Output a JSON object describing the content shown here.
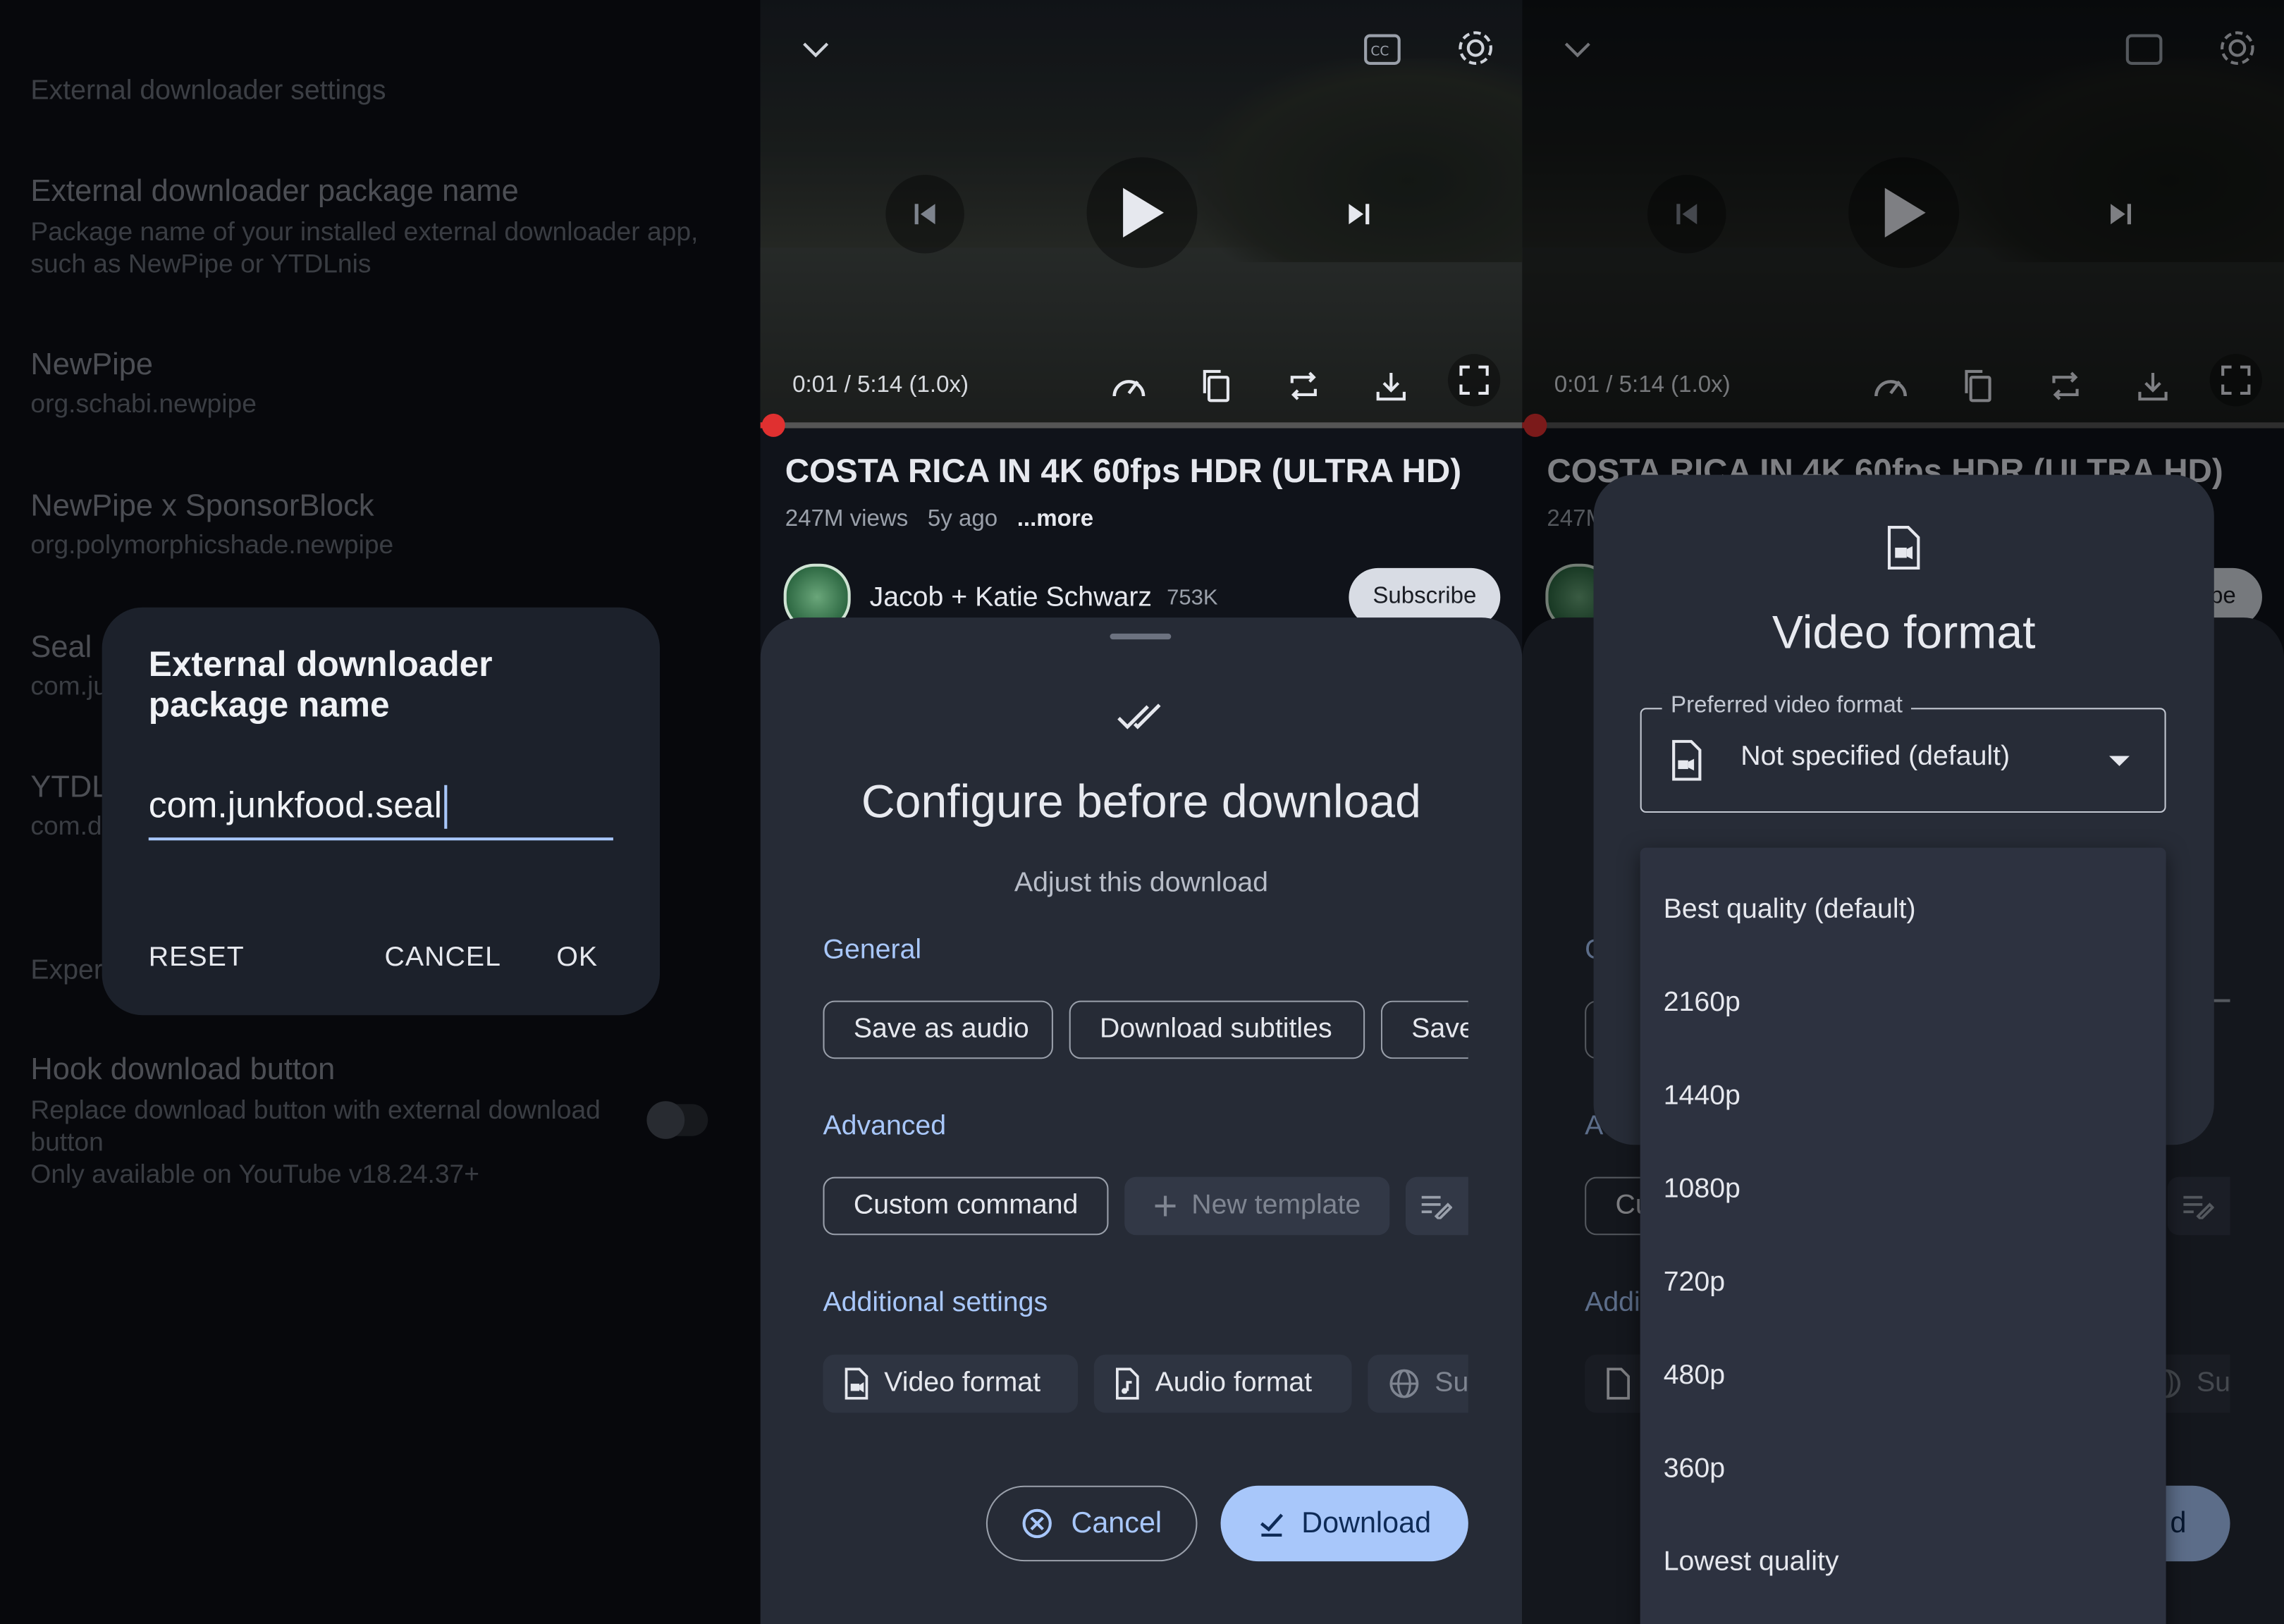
{
  "settings": {
    "header": "External downloader settings",
    "package_name": {
      "title": "External downloader package name",
      "desc": "Package name of your installed external downloader app, such as NewPipe or YTDLnis"
    },
    "options": [
      {
        "title": "NewPipe",
        "value": "org.schabi.newpipe"
      },
      {
        "title": "NewPipe x SponsorBlock",
        "value": "org.polymorphicshade.newpipe"
      },
      {
        "title": "Seal",
        "value": "com.ju"
      },
      {
        "title": "YTDL",
        "value": "com.d"
      }
    ],
    "experimental_header": "Exper",
    "hook": {
      "title": "Hook download button",
      "desc": "Replace download button with external download button\nOnly available on YouTube v18.24.37+",
      "enabled": false
    }
  },
  "dialog": {
    "title": "External downloader package name",
    "input_value": "com.junkfood.seal",
    "reset": "RESET",
    "cancel": "CANCEL",
    "ok": "OK"
  },
  "player": {
    "time": "0:01 / 5:14 (1.0x)",
    "title": "COSTA RICA IN 4K 60fps HDR (ULTRA HD)",
    "views": "247M views",
    "age": "5y ago",
    "more": "...more",
    "channel": "Jacob + Katie Schwarz",
    "subscribers": "753K",
    "subscribe": "Subscribe",
    "progress": 0.003
  },
  "sheet": {
    "title": "Configure before download",
    "subtitle": "Adjust this download",
    "general": "General",
    "general_chips": [
      "Save as audio",
      "Download subtitles",
      "Save"
    ],
    "advanced": "Advanced",
    "custom_command": "Custom command",
    "new_template": "New template",
    "additional": "Additional settings",
    "video_format": "Video format",
    "audio_format": "Audio format",
    "subtitle_chip": "Su",
    "cancel": "Cancel",
    "download": "Download"
  },
  "video_format_dialog": {
    "title": "Video format",
    "field_label": "Preferred video format",
    "field_value": "Not specified (default)",
    "options": [
      "Best quality (default)",
      "2160p",
      "1440p",
      "1080p",
      "720p",
      "480p",
      "360p",
      "Lowest quality"
    ]
  },
  "overlay_fragments": {
    "title": "COSTA RICA IN 4K 60fps HDR (ULTRA HD)",
    "views": "247M",
    "subscribe": "be",
    "chip": "Cu",
    "additional": "Addi",
    "general": "G",
    "advanced": "Ac",
    "save": "ve",
    "subtitle": "Su",
    "download": "d"
  },
  "colors": {
    "accent": "#a8c7fa",
    "background": "#0d1016",
    "sheet": "#262b36",
    "progress": "#e03030"
  }
}
